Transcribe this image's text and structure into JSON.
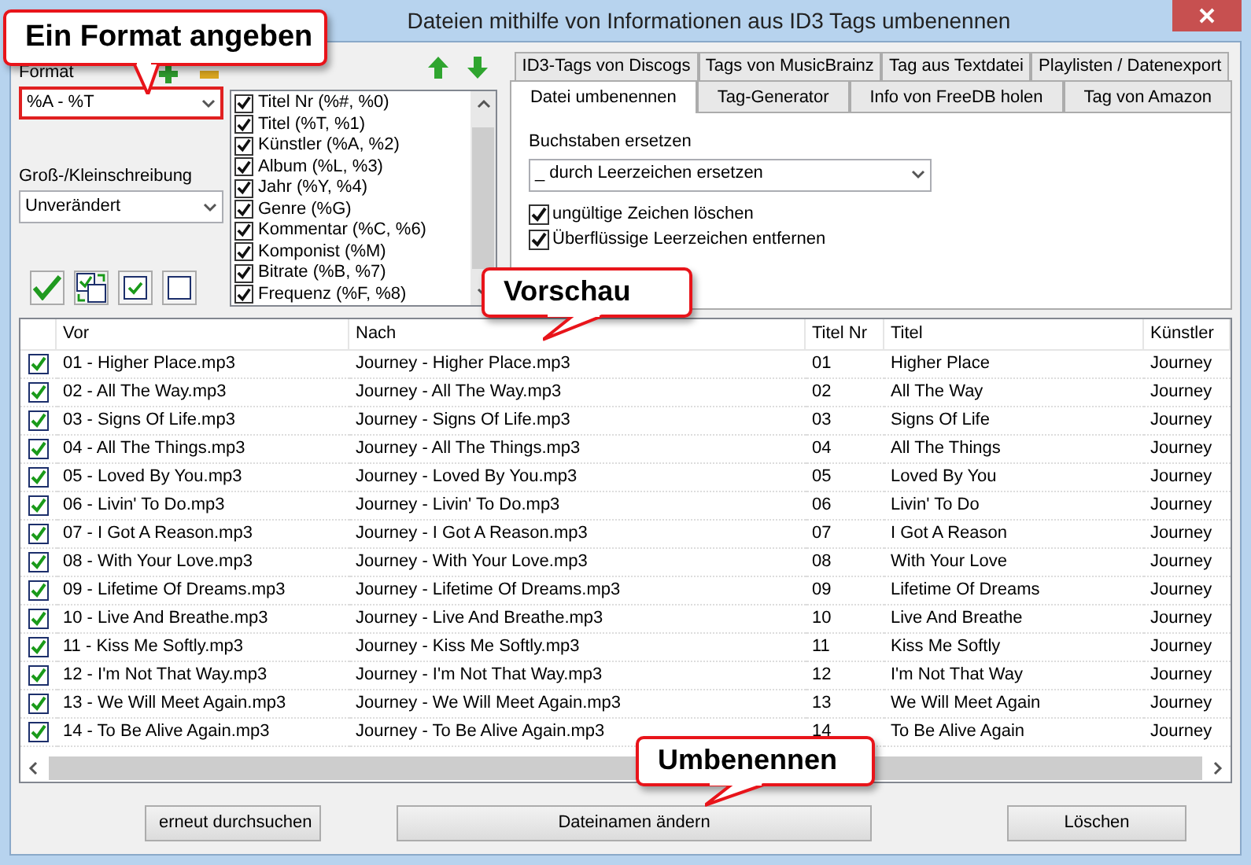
{
  "window": {
    "title": "Dateien mithilfe von Informationen aus ID3 Tags umbenennen"
  },
  "callouts": [
    {
      "text": "Ein Format angeben"
    },
    {
      "text": "Vorschau"
    },
    {
      "text": "Umbenennen"
    }
  ],
  "format": {
    "label": "Format",
    "value": "%A - %T"
  },
  "case": {
    "label": "Groß-/Kleinschreibung",
    "value": "Unverändert"
  },
  "tag_fields": [
    {
      "label": "Titel Nr (%#, %0)",
      "checked": true
    },
    {
      "label": "Titel (%T, %1)",
      "checked": true
    },
    {
      "label": "Künstler (%A, %2)",
      "checked": true
    },
    {
      "label": "Album (%L, %3)",
      "checked": true
    },
    {
      "label": "Jahr (%Y, %4)",
      "checked": true
    },
    {
      "label": "Genre (%G)",
      "checked": true
    },
    {
      "label": "Kommentar (%C, %6)",
      "checked": true
    },
    {
      "label": "Komponist (%M)",
      "checked": true
    },
    {
      "label": "Bitrate (%B, %7)",
      "checked": true
    },
    {
      "label": "Frequenz (%F, %8)",
      "checked": true
    }
  ],
  "tabs_back": [
    {
      "label": "ID3-Tags von Discogs",
      "selected": false
    },
    {
      "label": "Tags von MusicBrainz",
      "selected": false
    },
    {
      "label": "Tag aus Textdatei",
      "selected": false
    },
    {
      "label": "Playlisten / Datenexport",
      "selected": false
    }
  ],
  "tabs_front": [
    {
      "label": "Datei umbenennen",
      "selected": true
    },
    {
      "label": "Tag-Generator",
      "selected": false
    },
    {
      "label": "Info von FreeDB holen",
      "selected": false
    },
    {
      "label": "Tag von Amazon",
      "selected": false
    }
  ],
  "panel": {
    "replace_label": "Buchstaben ersetzen",
    "replace_value": "_ durch Leerzeichen ersetzen",
    "options": [
      {
        "label": "ungültige Zeichen löschen",
        "checked": true
      },
      {
        "label": "Überflüssige Leerzeichen entfernen",
        "checked": true
      }
    ]
  },
  "table": {
    "columns": [
      "Vor",
      "Nach",
      "Titel Nr",
      "Titel",
      "Künstler"
    ],
    "rows": [
      {
        "checked": true,
        "cells": [
          "01 - Higher Place.mp3",
          "Journey - Higher Place.mp3",
          "01",
          "Higher Place",
          "Journey"
        ]
      },
      {
        "checked": true,
        "cells": [
          "02 - All The Way.mp3",
          "Journey - All The Way.mp3",
          "02",
          "All The Way",
          "Journey"
        ]
      },
      {
        "checked": true,
        "cells": [
          "03 - Signs Of Life.mp3",
          "Journey - Signs Of Life.mp3",
          "03",
          "Signs Of Life",
          "Journey"
        ]
      },
      {
        "checked": true,
        "cells": [
          "04 - All The Things.mp3",
          "Journey - All The Things.mp3",
          "04",
          "All The Things",
          "Journey"
        ]
      },
      {
        "checked": true,
        "cells": [
          "05 - Loved By You.mp3",
          "Journey - Loved By You.mp3",
          "05",
          "Loved By You",
          "Journey"
        ]
      },
      {
        "checked": true,
        "cells": [
          "06 - Livin' To Do.mp3",
          "Journey - Livin' To Do.mp3",
          "06",
          "Livin' To Do",
          "Journey"
        ]
      },
      {
        "checked": true,
        "cells": [
          "07 - I Got A Reason.mp3",
          "Journey - I Got A Reason.mp3",
          "07",
          "I Got A Reason",
          "Journey"
        ]
      },
      {
        "checked": true,
        "cells": [
          "08 - With Your Love.mp3",
          "Journey - With Your Love.mp3",
          "08",
          "With Your Love",
          "Journey"
        ]
      },
      {
        "checked": true,
        "cells": [
          "09 - Lifetime Of Dreams.mp3",
          "Journey - Lifetime Of Dreams.mp3",
          "09",
          "Lifetime Of Dreams",
          "Journey"
        ]
      },
      {
        "checked": true,
        "cells": [
          "10 - Live And Breathe.mp3",
          "Journey - Live And Breathe.mp3",
          "10",
          "Live And Breathe",
          "Journey"
        ]
      },
      {
        "checked": true,
        "cells": [
          "11 - Kiss Me Softly.mp3",
          "Journey - Kiss Me Softly.mp3",
          "11",
          "Kiss Me Softly",
          "Journey"
        ]
      },
      {
        "checked": true,
        "cells": [
          "12 - I'm Not That Way.mp3",
          "Journey - I'm Not That Way.mp3",
          "12",
          "I'm Not That Way",
          "Journey"
        ]
      },
      {
        "checked": true,
        "cells": [
          "13 - We Will Meet Again.mp3",
          "Journey - We Will Meet Again.mp3",
          "13",
          "We Will Meet Again",
          "Journey"
        ]
      },
      {
        "checked": true,
        "cells": [
          "14 - To Be Alive Again.mp3",
          "Journey - To Be Alive Again.mp3",
          "14",
          "To Be Alive Again",
          "Journey"
        ]
      }
    ]
  },
  "buttons": [
    "erneut durchsuchen",
    "Dateinamen ändern",
    "Löschen"
  ]
}
